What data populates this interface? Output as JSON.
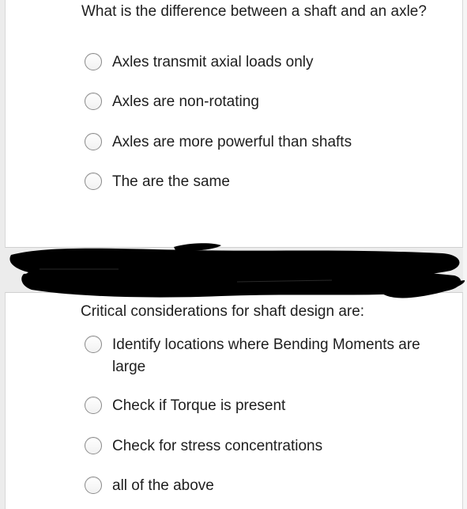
{
  "questions": [
    {
      "text": "What is the difference between a shaft and an axle?",
      "options": [
        "Axles transmit axial loads only",
        "Axles are non-rotating",
        "Axles are more powerful than shafts",
        "The are the same"
      ]
    },
    {
      "text": "Critical considerations for shaft design are:",
      "options": [
        "Identify locations where Bending Moments are large",
        "Check if Torque is present",
        "Check for stress concentrations",
        "all of the above"
      ]
    }
  ]
}
